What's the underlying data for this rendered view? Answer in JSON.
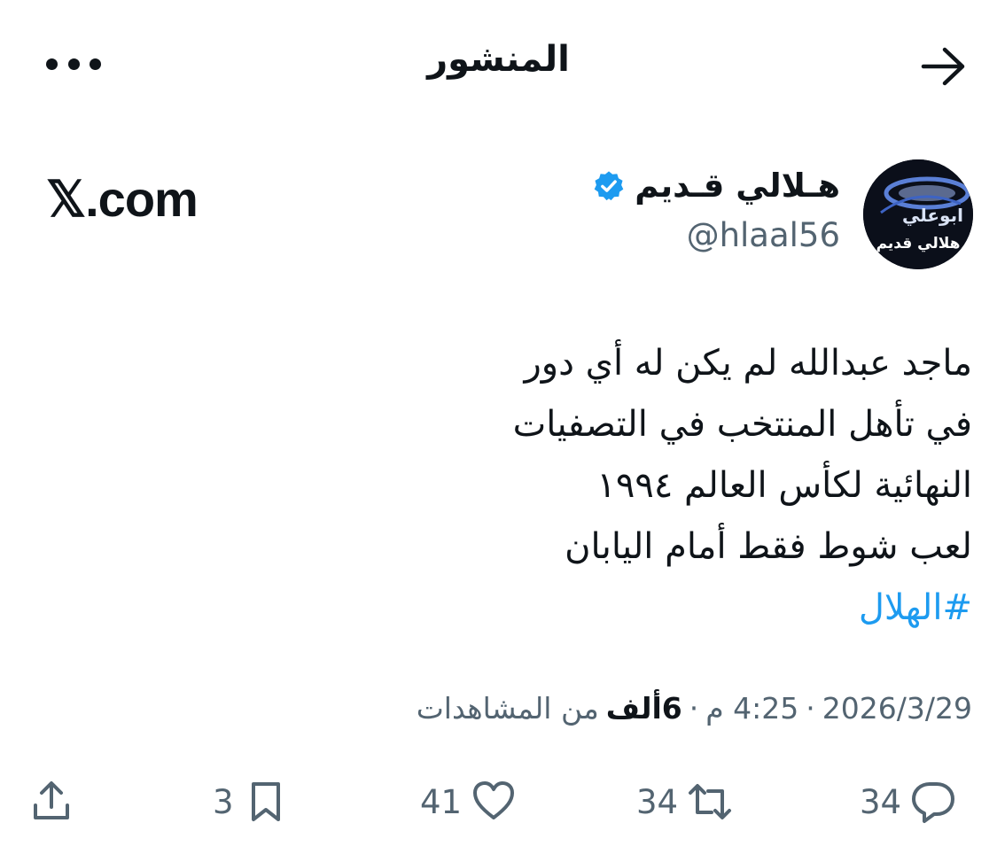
{
  "header": {
    "title": "المنشور",
    "back_icon": "arrow-right-icon",
    "more_icon": "more-horizontal-icon"
  },
  "author": {
    "name": "هـلالي قـديم",
    "handle": "@hlaal56",
    "verified": true,
    "avatar_text_top": "ابوعلي",
    "avatar_text_bottom": "هلالي قديم"
  },
  "watermark": "𝕏.com",
  "tweet": {
    "lines": [
      "ماجد عبدالله لم يكن له أي دور",
      "في تأهل المنتخب في التصفيات",
      "النهائية لكأس العالم ١٩٩٤",
      "لعب شوط فقط أمام اليابان"
    ],
    "hashtag": "#الهلال"
  },
  "meta": {
    "date": "2026/3/29",
    "time": "4:25 م",
    "views_count": "6ألف",
    "views_label": "من المشاهدات",
    "separator": "·"
  },
  "actions": {
    "replies": "34",
    "reposts": "34",
    "likes": "41",
    "bookmarks": "3"
  },
  "colors": {
    "text": "#0f1419",
    "secondary": "#536471",
    "accent": "#1d9bf0"
  }
}
